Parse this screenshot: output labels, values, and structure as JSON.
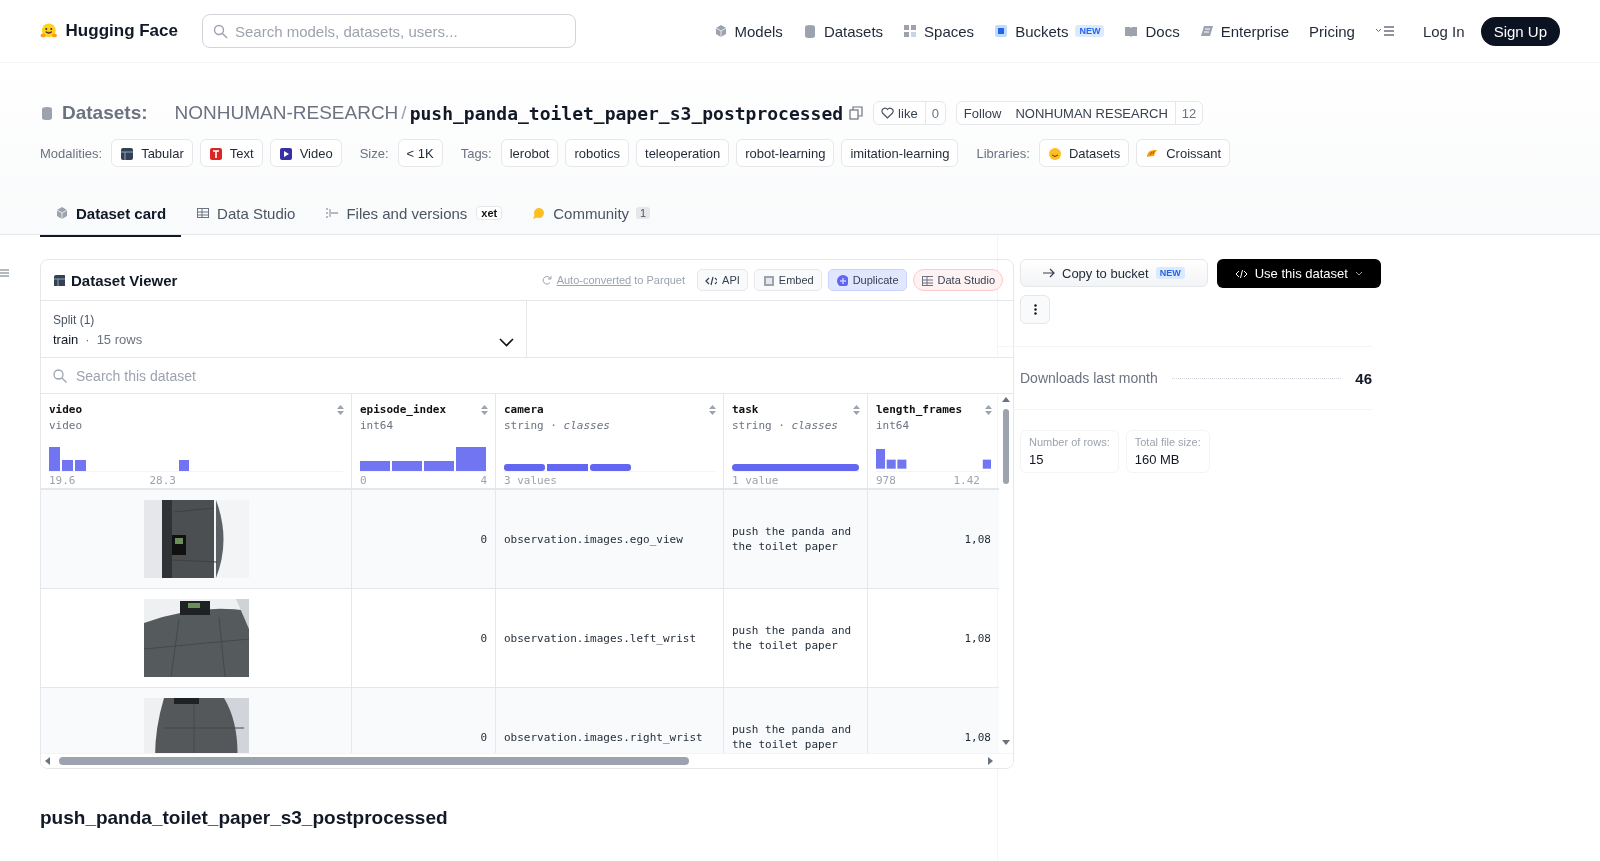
{
  "header": {
    "brand": "Hugging Face",
    "search": {
      "placeholder": "Search models, datasets, users..."
    },
    "nav": [
      {
        "label": "Models"
      },
      {
        "label": "Datasets"
      },
      {
        "label": "Spaces"
      },
      {
        "label": "Buckets",
        "badge": "NEW"
      },
      {
        "label": "Docs"
      },
      {
        "label": "Enterprise"
      },
      {
        "label": "Pricing"
      }
    ],
    "login": "Log In",
    "signup": "Sign Up"
  },
  "repo": {
    "type": "Datasets:",
    "owner": "NONHUMAN-RESEARCH",
    "separator": "/",
    "name": "push_panda_toilet_paper_s3_postprocessed",
    "like": {
      "label": "like",
      "count": "0"
    },
    "follow": {
      "label": "Follow",
      "org": "NONHUMAN RESEARCH",
      "count": "12"
    }
  },
  "meta": [
    {
      "label": "Modalities:",
      "chips": [
        "Tabular",
        "Text",
        "Video"
      ]
    },
    {
      "label": "Size:",
      "chips": [
        "< 1K"
      ]
    },
    {
      "label": "Tags:",
      "chips": [
        "lerobot",
        "robotics",
        "teleoperation",
        "robot-learning",
        "imitation-learning"
      ]
    },
    {
      "label": "Libraries:",
      "chips": [
        "Datasets",
        "Croissant"
      ]
    }
  ],
  "tabs": [
    {
      "label": "Dataset card",
      "selected": true
    },
    {
      "label": "Data Studio",
      "selected": false
    },
    {
      "label": "Files and versions",
      "badge": "xet",
      "selected": false
    },
    {
      "label": "Community",
      "count": "1",
      "selected": false
    }
  ],
  "viewer": {
    "title": "Dataset Viewer",
    "converted": {
      "link": "Auto-converted",
      "text": "to Parquet"
    },
    "actions": [
      {
        "label": "API",
        "kind": "plain"
      },
      {
        "label": "Embed",
        "kind": "plain"
      },
      {
        "label": "Duplicate",
        "kind": "blue"
      },
      {
        "label": "Data Studio",
        "kind": "red"
      }
    ],
    "split": {
      "label": "Split (1)",
      "value": "train",
      "separator": "·",
      "rows": "15 rows"
    },
    "search": {
      "placeholder": "Search this dataset"
    },
    "columns": [
      {
        "name": "video",
        "type": "video",
        "min": "19.6",
        "max": "28.3"
      },
      {
        "name": "episode_index",
        "type": "int64",
        "min": "0",
        "max": "4"
      },
      {
        "name": "camera",
        "type": "string · *classes*",
        "min": "3 values"
      },
      {
        "name": "task",
        "type": "string · *classes*",
        "min": "1 value"
      },
      {
        "name": "length_frames",
        "type": "int64",
        "min": "978",
        "max": "1.42"
      }
    ],
    "rows": [
      {
        "episode_index": "0",
        "camera": "observation.images.ego_view",
        "task": "push the panda and the toilet paper",
        "length_frames": "1,08"
      },
      {
        "episode_index": "0",
        "camera": "observation.images.left_wrist",
        "task": "push the panda and the toilet paper",
        "length_frames": "1,08"
      },
      {
        "episode_index": "0",
        "camera": "observation.images.right_wrist",
        "task": "push the panda and the toilet paper",
        "length_frames": "1,08"
      }
    ]
  },
  "card_title": "push_panda_toilet_paper_s3_postprocessed",
  "sidebar": {
    "copy": {
      "label": "Copy to bucket",
      "badge": "NEW"
    },
    "use": {
      "label": "Use this dataset"
    },
    "downloads": {
      "label": "Downloads last month",
      "value": "46"
    },
    "stats": [
      {
        "label": "Number of rows:",
        "value": "15"
      },
      {
        "label": "Total file size:",
        "value": "160 MB"
      }
    ]
  }
}
